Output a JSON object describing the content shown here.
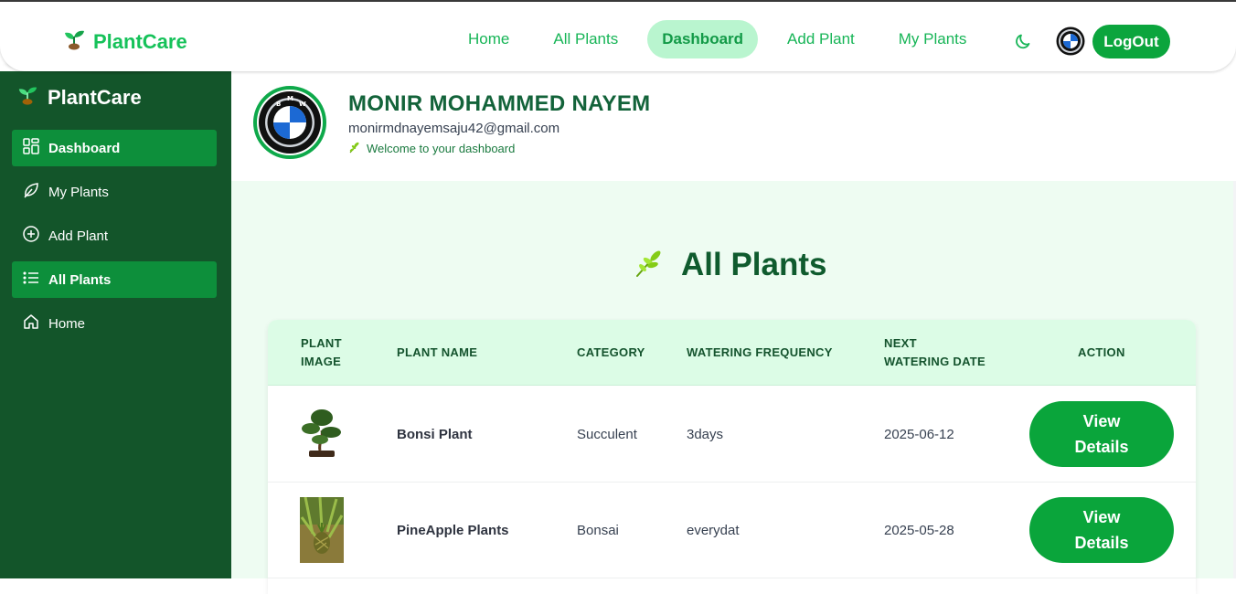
{
  "navbar": {
    "brand": "PlantCare",
    "links": [
      {
        "label": "Home"
      },
      {
        "label": "All Plants"
      },
      {
        "label": "Dashboard",
        "active": true
      },
      {
        "label": "Add Plant"
      },
      {
        "label": "My Plants"
      }
    ],
    "theme_icon": "moon-icon",
    "avatar_icon": "bmw-logo",
    "logout_label": "LogOut"
  },
  "sidebar": {
    "brand": "PlantCare",
    "items": [
      {
        "label": "Dashboard",
        "icon": "grid-icon",
        "active": true
      },
      {
        "label": "My Plants",
        "icon": "leaf-icon"
      },
      {
        "label": "Add Plant",
        "icon": "plus-circle-icon"
      },
      {
        "label": "All Plants",
        "icon": "list-icon",
        "active": true
      },
      {
        "label": "Home",
        "icon": "home-icon"
      }
    ]
  },
  "profile": {
    "name": "MONIR MOHAMMED NAYEM",
    "email": "monirmdnayemsaju42@gmail.com",
    "welcome": "Welcome to your dashboard"
  },
  "page": {
    "heading": "All Plants",
    "heading_icon": "herb-icon"
  },
  "table": {
    "headers": {
      "image_1": "PLANT",
      "image_2": "IMAGE",
      "name": "PLANT NAME",
      "category": "CATEGORY",
      "frequency": "WATERING FREQUENCY",
      "next_1": "NEXT",
      "next_2": "WATERING DATE",
      "action": "ACTION"
    },
    "rows": [
      {
        "image": "bonsai-tree-photo",
        "name": "Bonsi Plant",
        "category": "Succulent",
        "frequency": "3days",
        "next_date": "2025-06-12",
        "action": "View Details"
      },
      {
        "image": "pineapple-plant-photo",
        "name": "PineApple Plants",
        "category": "Bonsai",
        "frequency": "everydat",
        "next_date": "2025-05-28",
        "action": "View Details"
      }
    ]
  },
  "colors": {
    "brand_green": "#16c25a",
    "sidebar_bg": "#13552a",
    "sidebar_active": "#0d8f3b",
    "button_green": "#0aa53b",
    "content_bg": "#eefcf2",
    "table_header_bg": "#dcfce6"
  }
}
